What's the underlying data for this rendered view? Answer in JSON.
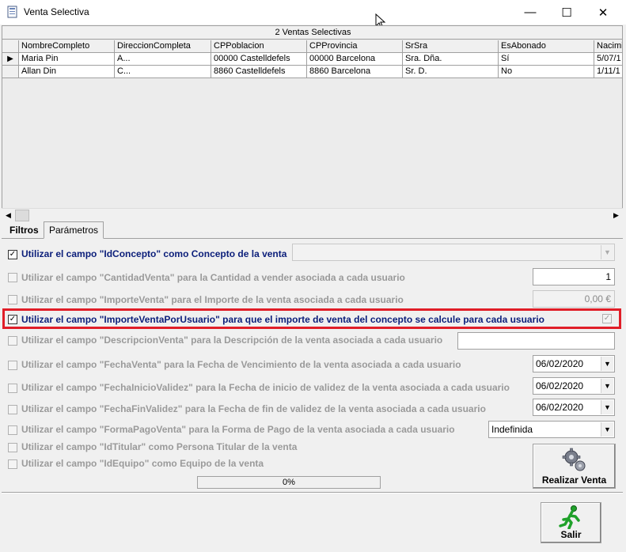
{
  "window": {
    "title": "Venta Selectiva",
    "minimize": "—",
    "maximize": "☐",
    "close": "✕"
  },
  "grid": {
    "caption": "2 Ventas Selectivas",
    "columns": [
      "NombreCompleto",
      "DireccionCompleta",
      "CPPoblacion",
      "CPProvincia",
      "SrSra",
      "EsAbonado",
      "Nacimi"
    ],
    "rows": [
      [
        "Maria Pin",
        "A...",
        "00000 Castelldefels",
        "00000 Barcelona",
        "Sra.  Dña.",
        "Sí",
        "5/07/1"
      ],
      [
        "Allan Din",
        "C...",
        "8860 Castelldefels",
        "8860 Barcelona",
        "Sr. D.",
        "No",
        "1/11/1"
      ]
    ],
    "row_indicator": "▶"
  },
  "tabs": {
    "filtros": "Filtros",
    "parametros": "Parámetros"
  },
  "params": {
    "idconcepto": {
      "label": "Utilizar el campo \"IdConcepto\" como Concepto de la venta",
      "checked": "✓",
      "value": ""
    },
    "cantidad": {
      "label": "Utilizar el campo \"CantidadVenta\" para la Cantidad a vender asociada a cada usuario",
      "value": "1"
    },
    "importe": {
      "label": "Utilizar el campo \"ImporteVenta\" para el Importe de la venta asociada a cada usuario",
      "value": "0,00 €"
    },
    "importe_usuario": {
      "label": "Utilizar el campo \"ImporteVentaPorUsuario\" para que el importe de venta del concepto se calcule para cada usuario",
      "checked": "✓",
      "right_check": "✓"
    },
    "descripcion": {
      "label": "Utilizar el campo \"DescripcionVenta\" para la Descripción de la venta asociada a cada usuario",
      "value": ""
    },
    "fecha_venta": {
      "label": "Utilizar el campo \"FechaVenta\" para la Fecha de Vencimiento de la venta asociada a cada usuario",
      "value": "06/02/2020"
    },
    "fecha_inicio": {
      "label": "Utilizar el campo \"FechaInicioValidez\" para la Fecha de inicio de validez de la venta asociada a cada usuario",
      "value": "06/02/2020"
    },
    "fecha_fin": {
      "label": "Utilizar el campo \"FechaFinValidez\" para la Fecha de fin de validez de la venta asociada a cada usuario",
      "value": "06/02/2020"
    },
    "forma_pago": {
      "label": "Utilizar el campo \"FormaPagoVenta\" para la Forma de Pago de la venta asociada a cada usuario",
      "value": "Indefinida"
    },
    "titular": {
      "label": "Utilizar el campo \"IdTitular\" como Persona Titular de la venta"
    },
    "equipo": {
      "label": "Utilizar el campo \"IdEquipo\" como Equipo de la venta"
    }
  },
  "progress": {
    "text": "0%",
    "value": 0
  },
  "buttons": {
    "realizar": "Realizar Venta",
    "salir": "Salir"
  },
  "icons": {
    "dropdown": "▼",
    "scroll_left": "◀",
    "scroll_right": "▶"
  },
  "colors": {
    "accent_label": "#0b1e7a",
    "highlight": "#e01e28",
    "salir_icon": "#1fa12a"
  }
}
